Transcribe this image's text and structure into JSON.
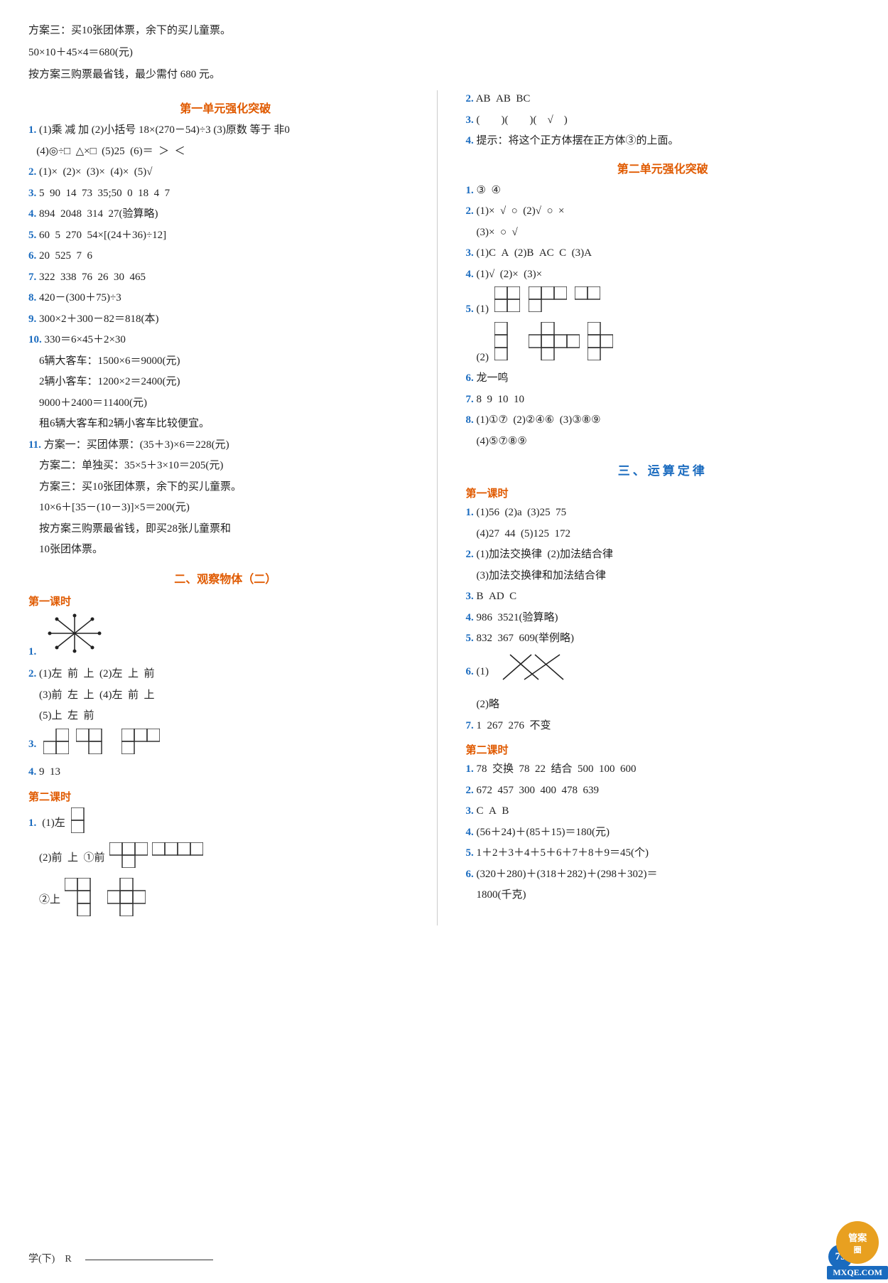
{
  "intro": {
    "plan3_line1": "方案三：买10张团体票，余下的买儿童票。",
    "plan3_line2": "50×10＋45×4＝680(元)",
    "plan3_line3": "按方案三购票最省钱，最少需付 680 元。"
  },
  "left_col": {
    "section1_title": "第一单元强化突破",
    "items": [
      {
        "num": "1.",
        "text": "(1)乘　减　加　(2)小括号　18×(270－54)÷3　(3)原数　等于　非0　(4)◎÷□　△×□　(5)25　(6)＝　＞　＜"
      },
      {
        "num": "2.",
        "text": "(1)×　(2)×　(3)×　(4)×　(5)√"
      },
      {
        "num": "3.",
        "text": "5　90　14　73　35;50　0　18　4　7"
      },
      {
        "num": "4.",
        "text": "894　2048　314　27(验算略)"
      },
      {
        "num": "5.",
        "text": "60　5　270　54×[(24＋36)÷12]"
      },
      {
        "num": "6.",
        "text": "20　525　7　6"
      },
      {
        "num": "7.",
        "text": "322　338　76　26　30　465"
      },
      {
        "num": "8.",
        "text": "420－(300＋75)÷3"
      },
      {
        "num": "9.",
        "text": "300×2＋300－82＝818(本)"
      },
      {
        "num": "10.",
        "text": "330＝6×45＋2×30"
      },
      {
        "num": "10_detail1",
        "text": "6辆大客车：1500×6＝9000(元)"
      },
      {
        "num": "10_detail2",
        "text": "2辆小客车：1200×2＝2400(元)"
      },
      {
        "num": "10_detail3",
        "text": "9000＋2400＝11400(元)"
      },
      {
        "num": "10_detail4",
        "text": "租6辆大客车和2辆小客车比较便宜。"
      },
      {
        "num": "11.",
        "text": "方案一：买团体票：(35＋3)×6＝228(元)"
      },
      {
        "num": "11b",
        "text": "方案二：单独买：35×5＋3×10＝205(元)"
      },
      {
        "num": "11c",
        "text": "方案三：买10张团体票，余下的买儿童票。"
      },
      {
        "num": "11d",
        "text": "10×6＋[35－(10－3)]×5＝200(元)"
      },
      {
        "num": "11e",
        "text": "按方案三购票最省钱，即买28张儿童票和10张团体票。"
      }
    ],
    "section2_title": "二、观察物体（二）",
    "subsec1": "第一课时",
    "diagram1_label": "1.",
    "observe_items": [
      {
        "num": "2.",
        "text": "(1)左　前　上　(2)左　上　前"
      },
      {
        "num": "2b",
        "text": "(3)前　左　上　(4)左　前　上"
      },
      {
        "num": "2c",
        "text": "(5)上　左　前"
      },
      {
        "num": "3.",
        "text": "（方块图形）"
      },
      {
        "num": "4.",
        "text": "9　13"
      }
    ],
    "subsec2": "第二课时",
    "observe2_items": [
      {
        "num": "1.",
        "text": "(1)左　（方块图）"
      },
      {
        "num": "1b",
        "text": "(2)前　上　①前　（方块图）　（方块图）"
      },
      {
        "num": "1c",
        "text": "②上　（方块图）　（方块图）"
      }
    ]
  },
  "right_col": {
    "top_items": [
      {
        "num": "2.",
        "text": "AB　AB　BC"
      },
      {
        "num": "3.",
        "text": "(　　)(　　)(　√　)"
      },
      {
        "num": "4.",
        "text": "提示：将这个正方体摆在正方体③的上面。"
      }
    ],
    "section1_title": "第二单元强化突破",
    "sec2_items": [
      {
        "num": "1.",
        "text": "③　④"
      },
      {
        "num": "2.",
        "text": "(1)×　√　○　(2)√　○　×"
      },
      {
        "num": "2b",
        "text": "(3)×　○　√"
      },
      {
        "num": "3.",
        "text": "(1)C　A　(2)B　AC　C　(3)A"
      },
      {
        "num": "4.",
        "text": "(1)√　(2)×　(3)×"
      },
      {
        "num": "5.",
        "text": "(1)（方块图）"
      },
      {
        "num": "5b",
        "text": "(2)（方块图）"
      },
      {
        "num": "6.",
        "text": "龙一鸣"
      },
      {
        "num": "7.",
        "text": "8　9　10　10"
      },
      {
        "num": "8.",
        "text": "(1)①⑦　(2)②④⑥　(3)③⑧⑨"
      },
      {
        "num": "8b",
        "text": "(4)⑤⑦⑧⑨"
      }
    ],
    "section3_title": "三、运算定律",
    "subsec1": "第一课时",
    "sec3_items": [
      {
        "num": "1.",
        "text": "(1)56　(2)a　(3)25　75"
      },
      {
        "num": "1b",
        "text": "(4)27　44　(5)125　172"
      },
      {
        "num": "2.",
        "text": "(1)加法交换律　(2)加法结合律"
      },
      {
        "num": "2b",
        "text": "(3)加法交换律和加法结合律"
      },
      {
        "num": "3.",
        "text": "B　AD　C"
      },
      {
        "num": "4.",
        "text": "986　3521(验算略)"
      },
      {
        "num": "5.",
        "text": "832　367　609(举例略)"
      },
      {
        "num": "6.",
        "text": "(1)（线条图）"
      },
      {
        "num": "6b",
        "text": "(2)略"
      },
      {
        "num": "7.",
        "text": "1　267　276　不变"
      }
    ],
    "subsec2": "第二课时",
    "sec3b_items": [
      {
        "num": "1.",
        "text": "78　交换　78　22　结合　500　100　600"
      },
      {
        "num": "2.",
        "text": "672　457　300　400　478　639"
      },
      {
        "num": "3.",
        "text": "C　A　B"
      },
      {
        "num": "4.",
        "text": "(56＋24)＋(85＋15)＝180(元)"
      },
      {
        "num": "5.",
        "text": "1＋2＋3＋4＋5＋6＋7＋8＋9＝45(个)"
      },
      {
        "num": "6.",
        "text": "(320＋280)＋(318＋282)＋(298＋302)＝1800(千克)"
      }
    ]
  },
  "footer": {
    "left_text": "学(下)　R",
    "page_num": "79",
    "watermark": "MXQE.COM"
  }
}
